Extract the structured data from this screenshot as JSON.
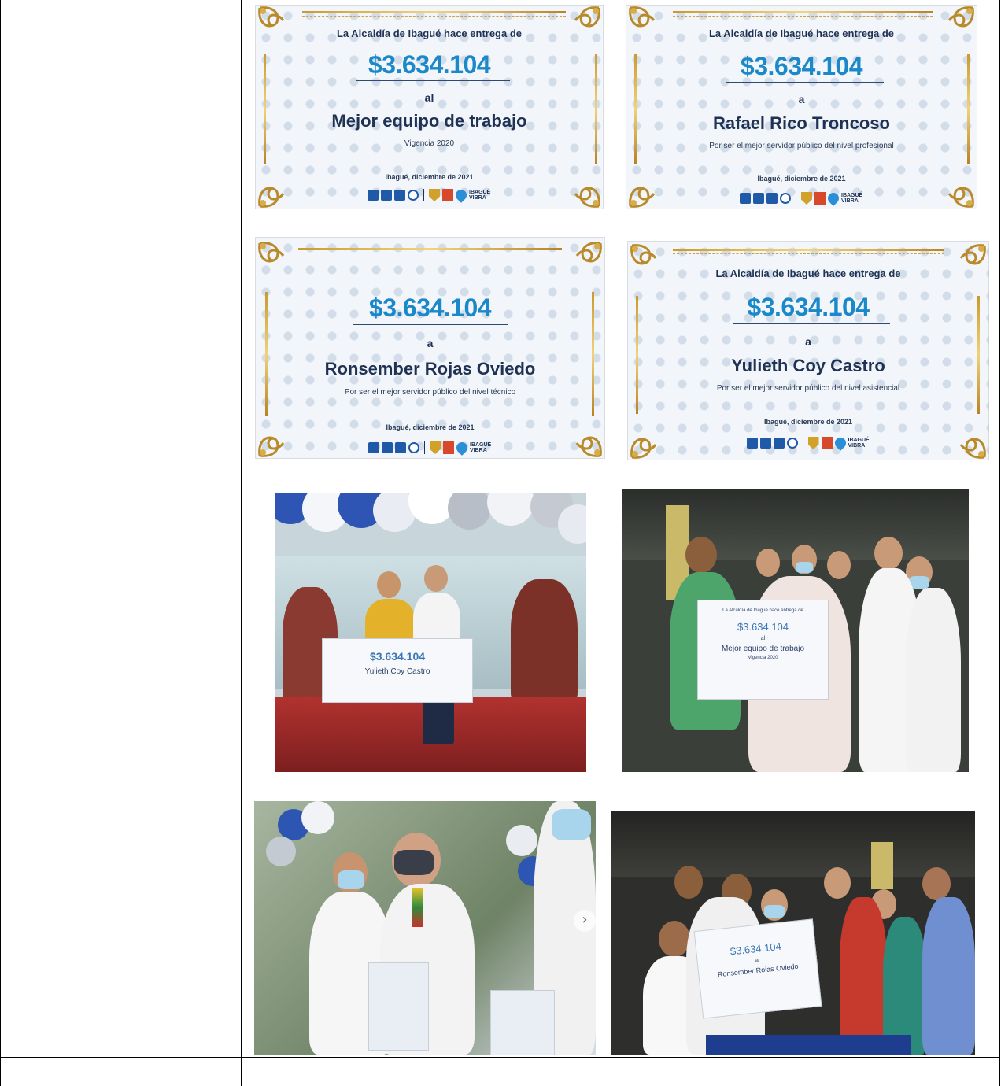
{
  "certificates": [
    {
      "heading": "La Alcaldía de Ibagué hace entrega de",
      "amount": "$3.634.104",
      "preposition": "al",
      "recipient": "Mejor equipo de trabajo",
      "reason": "Vigencia 2020",
      "date": "Ibagué, diciembre de 2021",
      "logo_text": "IBAGUÉ VIBRA"
    },
    {
      "heading": "La Alcaldía de Ibagué hace entrega de",
      "amount": "$3.634.104",
      "preposition": "a",
      "recipient": "Rafael Rico Troncoso",
      "reason": "Por ser el mejor servidor público del nivel profesional",
      "date": "Ibagué, diciembre de 2021",
      "logo_text": "IBAGUÉ VIBRA"
    },
    {
      "heading": "",
      "amount": "$3.634.104",
      "preposition": "a",
      "recipient": "Ronsember Rojas Oviedo",
      "reason": "Por ser el mejor servidor público del nivel técnico",
      "date": "Ibagué, diciembre de 2021",
      "logo_text": "IBAGUÉ VIBRA"
    },
    {
      "heading": "La Alcaldía de Ibagué hace entrega de",
      "amount": "$3.634.104",
      "preposition": "a",
      "recipient": "Yulieth Coy Castro",
      "reason": "Por ser el mejor servidor público del nivel asistencial",
      "date": "Ibagué, diciembre de 2021",
      "logo_text": "IBAGUÉ VIBRA"
    }
  ],
  "photos": {
    "photo1": {
      "banner_amount": "$3.634.104",
      "banner_name": "Yulieth Coy Castro"
    },
    "photo2": {
      "banner_heading": "La Alcaldía de Ibagué hace entrega de",
      "banner_amount": "$3.634.104",
      "banner_prep": "al",
      "banner_name": "Mejor equipo de trabajo",
      "banner_sub": "Vigencia 2020"
    },
    "photo3": {
      "nav_icon": "chevron-right-icon"
    },
    "photo4": {
      "banner_amount": "$3.634.104",
      "banner_prep": "a",
      "banner_name": "Ronsember Rojas Oviedo"
    }
  },
  "colors": {
    "amount_blue": "#1a88c9",
    "text_navy": "#1f3254",
    "gold": "#c99a2e"
  }
}
